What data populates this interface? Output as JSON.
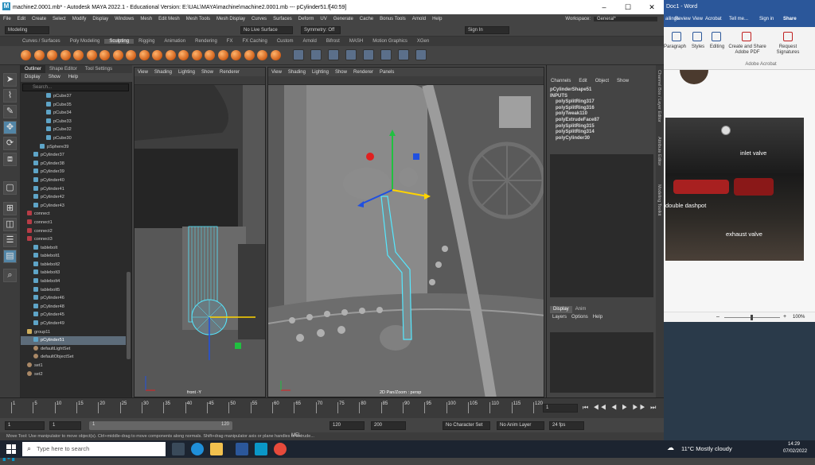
{
  "maya": {
    "window_title": "machine2.0001.mb* - Autodesk MAYA 2022.1 - Educational Version: E:\\UAL\\MAYA\\machine\\machine2.0001.mb  ---  pCylinder51.f[40:59]",
    "logo": "M",
    "window_controls": [
      "–",
      "☐",
      "✕"
    ],
    "menus": [
      "File",
      "Edit",
      "Create",
      "Select",
      "Modify",
      "Display",
      "Windows",
      "Mesh",
      "Edit Mesh",
      "Mesh Tools",
      "Mesh Display",
      "Curves",
      "Surfaces",
      "Deform",
      "UV",
      "Generate",
      "Cache",
      "Bonus Tools",
      "Arnold",
      "Help"
    ],
    "workspace_label": "Workspace:",
    "workspace_value": "General*",
    "mode_menu": "Modeling",
    "live_surface": "No Live Surface",
    "symmetry": "Symmetry: Off",
    "sign_in": "Sign In",
    "shelf_tabs": [
      "Curves / Surfaces",
      "Poly Modeling",
      "Sculpting",
      "Rigging",
      "Animation",
      "Rendering",
      "FX",
      "FX Caching",
      "Custom",
      "Arnold",
      "Bifrost",
      "MASH",
      "Motion Graphics",
      "XGen"
    ],
    "shelf_active": "Sculpting",
    "outliner": {
      "tabs": [
        "Outliner",
        "Shape Editor",
        "Tool Settings"
      ],
      "menu": [
        "Display",
        "Show",
        "Help"
      ],
      "search_placeholder": "Search...",
      "items": [
        {
          "name": "pCube37",
          "indent": 3,
          "icon": "mesh"
        },
        {
          "name": "pCube35",
          "indent": 3,
          "icon": "mesh"
        },
        {
          "name": "pCube34",
          "indent": 3,
          "icon": "mesh"
        },
        {
          "name": "pCube33",
          "indent": 3,
          "icon": "mesh"
        },
        {
          "name": "pCube32",
          "indent": 3,
          "icon": "mesh"
        },
        {
          "name": "pCube30",
          "indent": 3,
          "icon": "mesh"
        },
        {
          "name": "pSphere39",
          "indent": 2,
          "icon": "mesh"
        },
        {
          "name": "pCylinder37",
          "indent": 1,
          "icon": "mesh"
        },
        {
          "name": "pCylinder38",
          "indent": 1,
          "icon": "mesh"
        },
        {
          "name": "pCylinder39",
          "indent": 1,
          "icon": "mesh"
        },
        {
          "name": "pCylinder40",
          "indent": 1,
          "icon": "mesh"
        },
        {
          "name": "pCylinder41",
          "indent": 1,
          "icon": "mesh"
        },
        {
          "name": "pCylinder42",
          "indent": 1,
          "icon": "mesh"
        },
        {
          "name": "pCylinder43",
          "indent": 1,
          "icon": "mesh"
        },
        {
          "name": "connect",
          "indent": 0,
          "icon": "conn"
        },
        {
          "name": "connect1",
          "indent": 0,
          "icon": "conn"
        },
        {
          "name": "connect2",
          "indent": 0,
          "icon": "conn"
        },
        {
          "name": "connect3",
          "indent": 0,
          "icon": "conn"
        },
        {
          "name": "tablebolt",
          "indent": 1,
          "icon": "mesh"
        },
        {
          "name": "tablebolt1",
          "indent": 1,
          "icon": "mesh"
        },
        {
          "name": "tablebolt2",
          "indent": 1,
          "icon": "mesh"
        },
        {
          "name": "tablebolt3",
          "indent": 1,
          "icon": "mesh"
        },
        {
          "name": "tablebolt4",
          "indent": 1,
          "icon": "mesh"
        },
        {
          "name": "tablebolt5",
          "indent": 1,
          "icon": "mesh"
        },
        {
          "name": "pCylinder46",
          "indent": 1,
          "icon": "mesh"
        },
        {
          "name": "pCylinder48",
          "indent": 1,
          "icon": "mesh"
        },
        {
          "name": "pCylinder45",
          "indent": 1,
          "icon": "mesh"
        },
        {
          "name": "pCylinder49",
          "indent": 1,
          "icon": "mesh"
        },
        {
          "name": "group11",
          "indent": 0,
          "icon": "grp"
        },
        {
          "name": "pCylinder51",
          "indent": 1,
          "icon": "mesh",
          "selected": true
        },
        {
          "name": "defaultLightSet",
          "indent": 1,
          "icon": "set"
        },
        {
          "name": "defaultObjectSet",
          "indent": 1,
          "icon": "set"
        },
        {
          "name": "set1",
          "indent": 0,
          "icon": "set"
        },
        {
          "name": "set2",
          "indent": 0,
          "icon": "set"
        }
      ]
    },
    "viewport_left": {
      "menu": [
        "View",
        "Shading",
        "Lighting",
        "Show",
        "Renderer"
      ],
      "label": "front -Y"
    },
    "viewport_right": {
      "menu": [
        "View",
        "Shading",
        "Lighting",
        "Show",
        "Renderer",
        "Panels"
      ],
      "label": "2D Pan/Zoom : persp"
    },
    "channel_box": {
      "menu": [
        "Channels",
        "Edit",
        "Object",
        "Show"
      ],
      "shape": "pCylinderShape51",
      "inputs_label": "INPUTS",
      "inputs": [
        "polySplitRing317",
        "polySplitRing316",
        "polyTweak110",
        "polyExtrudeFace87",
        "polySplitRing315",
        "polySplitRing314",
        "polyCylinder30"
      ]
    },
    "layer_editor": {
      "tabs": [
        "Display",
        "Anim"
      ],
      "menu": [
        "Layers",
        "Options",
        "Help"
      ]
    },
    "side_tabs": [
      "Channel Box / Layer Editor",
      "Attribute Editor",
      "Modeling Toolkit"
    ],
    "timeline_ticks": [
      "1",
      "5",
      "10",
      "15",
      "20",
      "25",
      "30",
      "35",
      "40",
      "45",
      "50",
      "55",
      "60",
      "65",
      "70",
      "75",
      "80",
      "85",
      "90",
      "95",
      "100",
      "105",
      "110",
      "115",
      "120"
    ],
    "current_frame": "1",
    "range": {
      "start": "1",
      "inner_start": "1",
      "inner_end": "120",
      "end": "120",
      "anim_end": "200"
    },
    "no_character_set": "No Character Set",
    "no_anim_layer": "No Anim Layer",
    "fps": "24 fps",
    "cmd_text": "Move Tool: Use manipulator to move object(s). Ctrl+middle-drag to move components along normals. Shift+drag manipulator axis or plane handles to extrude...",
    "mel_label": "MEL"
  },
  "word": {
    "title": "Doc1 - Word",
    "tabs": [
      "ailings",
      "Review",
      "View",
      "Acrobat"
    ],
    "tell_me": "Tell me...",
    "sign_in": "Sign in",
    "share": "Share",
    "ribbon": [
      "Paragraph",
      "Styles",
      "Editing"
    ],
    "acrobat_btn1": "Create and Share Adobe PDF",
    "acrobat_btn2": "Request Signatures",
    "group_label": "Adobe Acrobat",
    "photo_labels": [
      "inlet valve",
      "double dashpot",
      "exhaust valve"
    ],
    "zoom": "100%",
    "zoom_minus": "–",
    "zoom_plus": "+"
  },
  "taskbar": {
    "search": "Type here to search",
    "weather": "11°C  Mostly cloudy",
    "time": "14:29",
    "date": "07/02/2022"
  },
  "colors": {
    "maya_accent": "#5285a6",
    "word_blue": "#2b579a",
    "selection": "#5d6c7a",
    "gizmo_red": "#e02020",
    "gizmo_green": "#20c040",
    "gizmo_blue": "#2050e0",
    "gizmo_yellow": "#ffd400",
    "wire": "#55e8ff"
  }
}
